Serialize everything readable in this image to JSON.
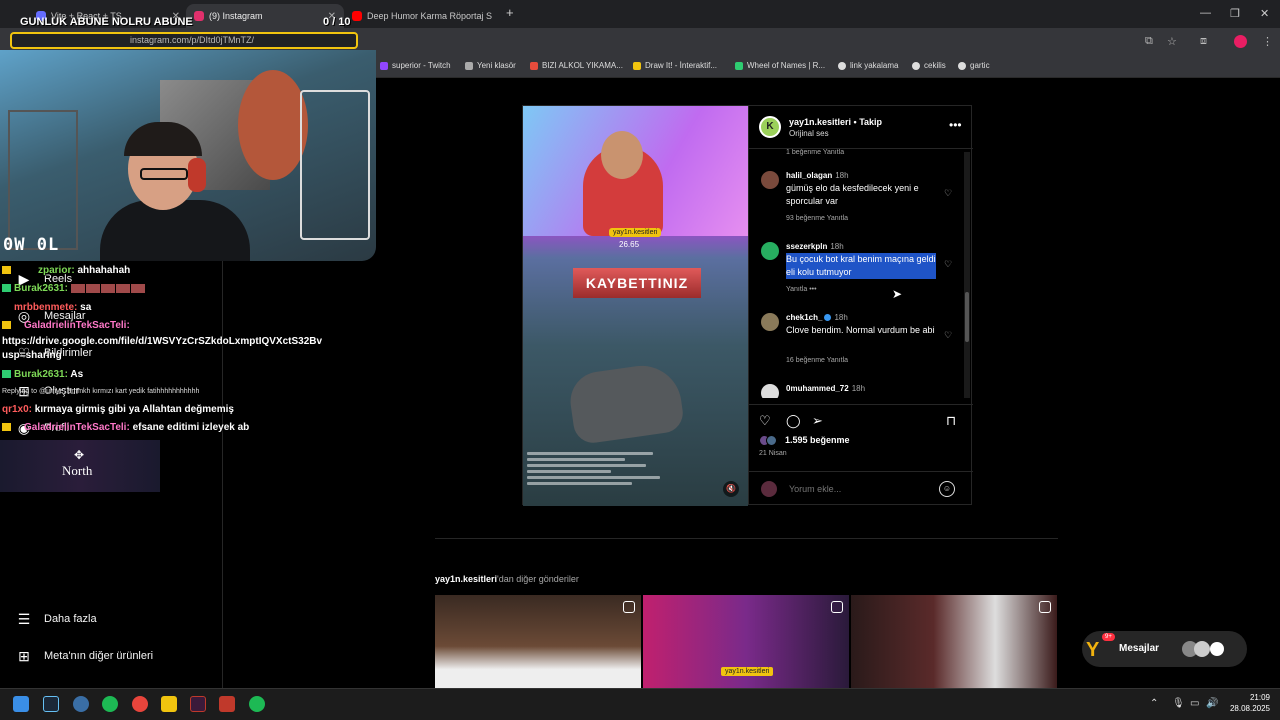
{
  "tabs": [
    {
      "title": "Vite + React + TS",
      "color": "#646cff"
    },
    {
      "title": "(9) Instagram",
      "color": "#e1306c"
    },
    {
      "title": "Deep Humor Karma Röportaj S",
      "color": "#ff0000"
    }
  ],
  "new_tab": "+",
  "address": "instagram.com/p/DItd0jTMnTZ/",
  "bookmarks": [
    {
      "label": "superior - Twitch",
      "color": "#9146ff"
    },
    {
      "label": "Yeni klasör",
      "color": "#aaaaaa"
    },
    {
      "label": "BIZI ALKOL YIKAMA...",
      "color": "#e74c3c"
    },
    {
      "label": "Draw It! - İnteraktif...",
      "color": "#f1c40f"
    },
    {
      "label": "Wheel of Names | R...",
      "color": "#2ecc71"
    },
    {
      "label": "link yakalama",
      "color": "#dddddd"
    },
    {
      "label": "cekilis",
      "color": "#dddddd"
    },
    {
      "label": "gartic",
      "color": "#dddddd"
    }
  ],
  "overlay": {
    "sub_title": "GUNLUK ABUNE NOLRU ABUNE",
    "sub_count": "0  / 10",
    "cam_logo": "0W 0L"
  },
  "chat": [
    {
      "user": "zparior:",
      "msg": "ahhahahah",
      "style": "g"
    },
    {
      "user": "Burak2631:",
      "msg": "",
      "style": "g",
      "emotes": true
    },
    {
      "user": "mrbbenmete:",
      "msg": "sa",
      "style": "r"
    },
    {
      "user": "GaladrielinTekSacTeli:",
      "msg": "",
      "style": "p"
    },
    {
      "user": "",
      "msg": "https://drive.google.com/file/d/1WSVYzCrSZkdoLxmptIQVXctS32Bv",
      "style": "plain"
    },
    {
      "user": "",
      "msg": "usp=sharing",
      "style": "plain"
    },
    {
      "user": "Burak2631:",
      "msg": "As",
      "style": "g"
    },
    {
      "user": "",
      "msg": "Replying to @urriye: ammkh kırmızı kart yedik fatihhhhhhhhhhh",
      "style": "small"
    },
    {
      "user": "qr1x0:",
      "msg": "kırmaya girmiş gibi ya Allahtan değmemiş",
      "style": "r"
    },
    {
      "user": "GaladrielinTekSacTeli:",
      "msg": "efsane editimi izleyek ab",
      "style": "p"
    }
  ],
  "sidebar": {
    "reels": "Reels",
    "messages": "Mesajlar",
    "notifications": "Bildirimler",
    "create": "Oluştur",
    "profile": "Profil",
    "more": "Daha fazla",
    "meta": "Meta'nın diğer ürünleri"
  },
  "north": {
    "label": "North"
  },
  "post": {
    "username": "yay1n.kesitleri • Takip",
    "audio": "Orijinal ses",
    "video_tag": "yay1n.kesitleri",
    "video_score": "26.65",
    "defeat_text": "KAYBETTINIZ",
    "top_meta": "1 beğenme    Yanıtla",
    "comments": [
      {
        "user": "halil_olagan",
        "time": "18h",
        "text": "gümüş elo da kesfedilecek yeni e sporcular var",
        "meta": "93 beğenme    Yanıtla",
        "color": "#7a4a3c",
        "selected": false
      },
      {
        "user": "ssezerkpln",
        "time": "18h",
        "text": "Bu çocuk bot kral benim maçına geldi eli kolu tutmuyor",
        "meta": "Yanıtla    •••",
        "color": "#27ae60",
        "selected": true
      },
      {
        "user": "chek1ch_",
        "time": "18h",
        "text": "Clove bendim. Normal vurdum be abi",
        "meta": "16 beğenme    Yanıtla",
        "color": "#8a7a5a",
        "selected": false,
        "verified": true
      },
      {
        "user": "0muhammed_72",
        "time": "18h",
        "text": "",
        "meta": "",
        "color": "#dddddd",
        "selected": false
      }
    ],
    "likes": "1.595 beğenme",
    "date": "21 Nisan",
    "add_comment_placeholder": "Yorum ekle..."
  },
  "more_posts": {
    "user": "yay1n.kesitleri",
    "suffix": "'dan diğer gönderiler",
    "thumb_tag": "yay1n.kesitleri"
  },
  "messages_bar": {
    "label": "Mesajlar",
    "badge": "9+"
  },
  "clock": {
    "time": "21:09",
    "date": "28.08.2025"
  }
}
